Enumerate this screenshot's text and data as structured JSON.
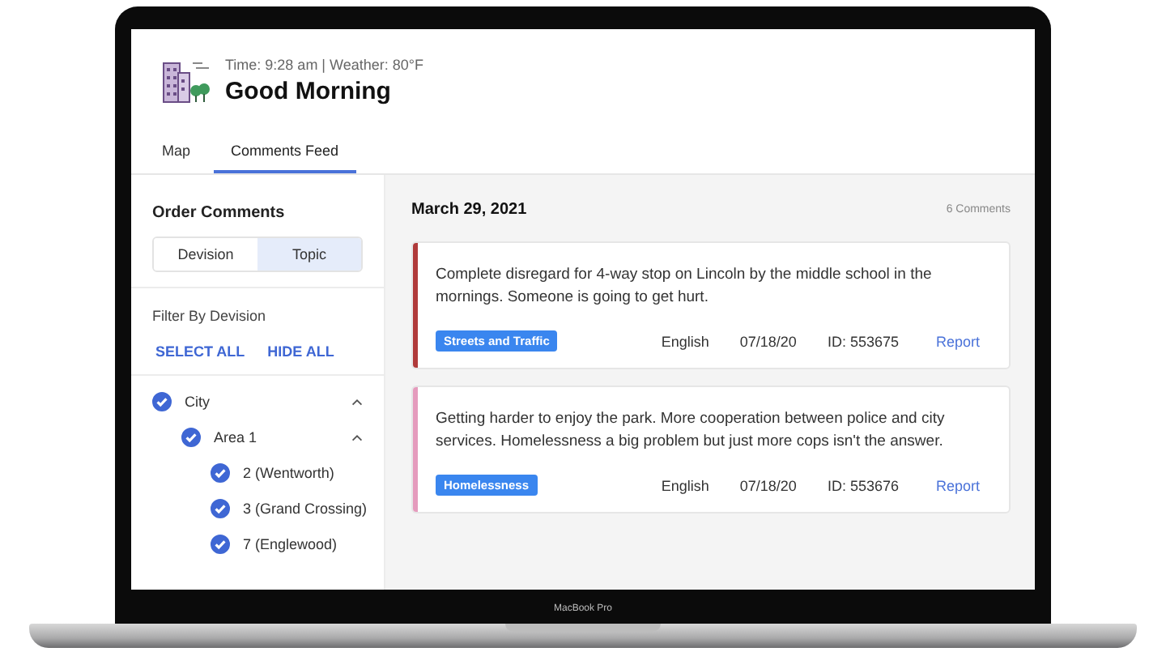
{
  "device": {
    "label": "MacBook Pro"
  },
  "header": {
    "info": "Time: 9:28 am | Weather: 80°F",
    "title": "Good Morning"
  },
  "tabs": [
    {
      "label": "Map",
      "selected": false
    },
    {
      "label": "Comments Feed",
      "selected": true
    }
  ],
  "sidebar": {
    "title": "Order Comments",
    "segments": [
      {
        "label": "Devision",
        "selected": false
      },
      {
        "label": "Topic",
        "selected": true
      }
    ],
    "filter_label": "Filter By Devision",
    "actions": [
      "SELECT ALL",
      "HIDE ALL"
    ],
    "tree": [
      {
        "label": "City",
        "checked": true,
        "expanded": true,
        "children": [
          {
            "label": "Area 1",
            "checked": true,
            "expanded": true,
            "children": [
              {
                "label": "2 (Wentworth)",
                "checked": true
              },
              {
                "label": "3 (Grand Crossing)",
                "checked": true
              },
              {
                "label": "7 (Englewood)",
                "checked": true
              }
            ]
          }
        ]
      }
    ]
  },
  "feed": {
    "date": "March 29, 2021",
    "count": "6 Comments",
    "comments": [
      {
        "text": "Complete disregard for 4-way stop on Lincoln by the middle school in the mornings. Someone is going to get hurt.",
        "color": "#b03a3a",
        "tag": "Streets and Traffic",
        "language": "English",
        "date": "07/18/20",
        "id": "ID: 553675",
        "action": "Report"
      },
      {
        "text": "Getting harder to enjoy the park. More cooperation between police and city services. Homelessness a big problem but just more cops isn't the answer.",
        "color": "#e59bbd",
        "tag": "Homelessness",
        "language": "English",
        "date": "07/18/20",
        "id": "ID: 553676",
        "action": "Report"
      }
    ]
  }
}
